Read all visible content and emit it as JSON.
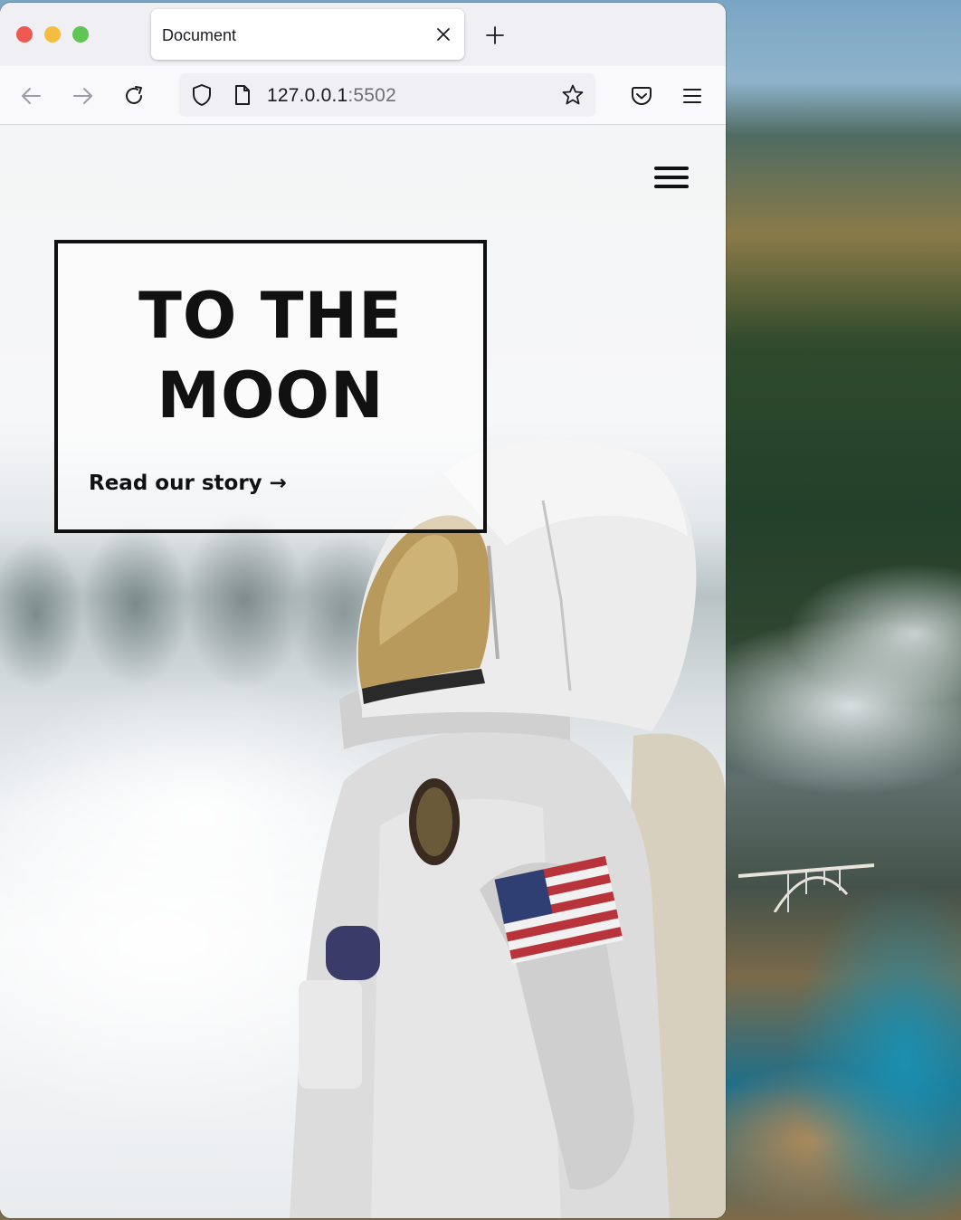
{
  "browser": {
    "tab_title": "Document",
    "url_host": "127.0.0.1",
    "url_port": ":5502"
  },
  "page": {
    "hero_title_line1": "TO THE",
    "hero_title_line2": "MOON",
    "cta_label": "Read our story",
    "cta_arrow": "→"
  },
  "icons": {
    "back": "back-arrow-icon",
    "forward": "forward-arrow-icon",
    "reload": "reload-icon",
    "shield": "shield-icon",
    "page": "page-icon",
    "star": "star-icon",
    "pocket": "pocket-icon",
    "app_menu": "hamburger-icon",
    "close_tab": "close-icon",
    "new_tab": "plus-icon",
    "site_menu": "hamburger-icon"
  },
  "colors": {
    "traffic_red": "#ee5a52",
    "traffic_yellow": "#f5bd3f",
    "traffic_green": "#5fc553",
    "hero_text": "#111111"
  }
}
